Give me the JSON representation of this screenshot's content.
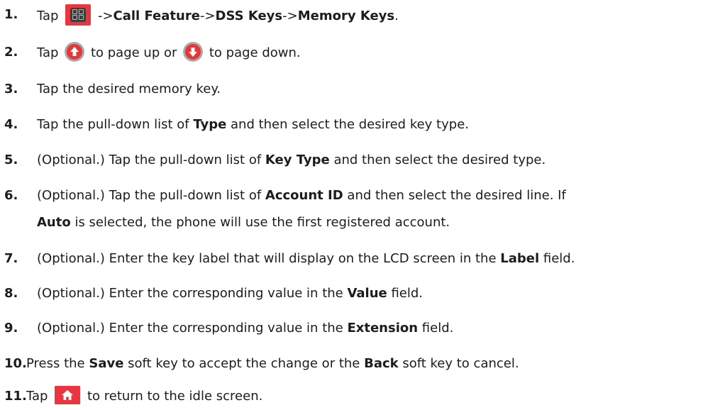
{
  "steps": [
    {
      "number": "1.",
      "parts": [
        "Tap",
        "->",
        "Call Feature",
        "->",
        "DSS Keys",
        "->",
        "Memory Keys",
        "."
      ],
      "icons": [
        "menu-icon"
      ]
    },
    {
      "number": "2.",
      "parts": [
        "Tap",
        "to page up or",
        "to page down."
      ],
      "icons": [
        "arrow-up-icon",
        "arrow-down-icon"
      ]
    },
    {
      "number": "3.",
      "text": "Tap the desired memory key."
    },
    {
      "number": "4.",
      "parts": [
        "Tap the pull-down list of ",
        "Type",
        " and then select the desired key type."
      ]
    },
    {
      "number": "5.",
      "parts": [
        "(Optional.) Tap the pull-down list of ",
        "Key Type",
        " and then select the desired type."
      ]
    },
    {
      "number": "6.",
      "parts": [
        "(Optional.) Tap the pull-down list of ",
        "Account ID",
        " and then select the desired line. If"
      ],
      "line2": [
        "Auto",
        " is selected, the phone will use the first registered account."
      ]
    },
    {
      "number": "7.",
      "parts": [
        "(Optional.) Enter the key label that will display on the LCD screen in the ",
        "Label",
        " field."
      ]
    },
    {
      "number": "8.",
      "parts": [
        "(Optional.) Enter the corresponding value in the ",
        "Value",
        " field."
      ]
    },
    {
      "number": "9.",
      "parts": [
        "(Optional.) Enter the corresponding value in the ",
        "Extension",
        " field."
      ]
    },
    {
      "number": "10.",
      "parts": [
        "Press the ",
        "Save",
        " soft key to accept the change or the ",
        "Back",
        " soft key to cancel."
      ]
    },
    {
      "number": "11.",
      "parts": [
        "Tap",
        "to return to the idle screen."
      ],
      "icons": [
        "home-icon"
      ]
    }
  ],
  "colors": {
    "accent": "#e8353f",
    "text": "#1c1c1c"
  }
}
